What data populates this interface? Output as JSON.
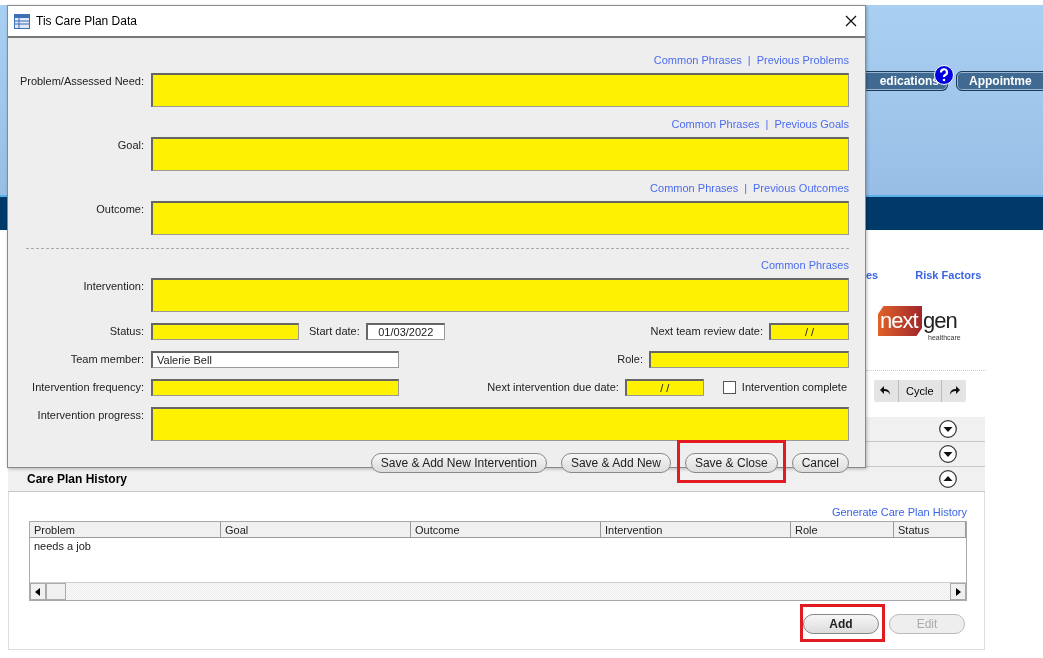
{
  "background": {
    "nav_buttons": [
      {
        "label": "edications"
      },
      {
        "label": "Appointme"
      }
    ],
    "links": [
      "es",
      "Risk Factors"
    ],
    "logo": {
      "first": "next",
      "second": "gen",
      "tagline": "healthcare"
    },
    "toolbar": {
      "label": "Cycle"
    },
    "sections": [
      {
        "expanded": false
      },
      {
        "expanded": false
      },
      {
        "title": "Care Plan History",
        "expanded": true
      }
    ],
    "history": {
      "link": "Generate Care Plan History",
      "columns": [
        "Problem",
        "Goal",
        "Outcome",
        "Intervention",
        "Role",
        "Status"
      ],
      "rows": [
        {
          "cells": [
            "needs a job"
          ]
        }
      ],
      "buttons": [
        {
          "label": "Add",
          "disabled": false,
          "highlighted": true
        },
        {
          "label": "Edit",
          "disabled": true,
          "highlighted": false
        }
      ]
    }
  },
  "dialog": {
    "title": "Tis Care Plan Data",
    "text_areas": [
      {
        "label": "Problem/Assessed Need:",
        "required": true,
        "divider_before": false,
        "links": [
          "Common Phrases",
          "|",
          "Previous Problems"
        ]
      },
      {
        "label": "Goal:",
        "required": true,
        "divider_before": false,
        "links": [
          "Common Phrases",
          "|",
          "Previous Goals"
        ]
      },
      {
        "label": "Outcome:",
        "required": true,
        "divider_before": false,
        "links": [
          "Common Phrases",
          "|",
          "Previous Outcomes"
        ]
      },
      {
        "label": "Intervention:",
        "required": true,
        "divider_before": true,
        "links": [
          "Common Phrases"
        ]
      }
    ],
    "status": {
      "label": "Status:",
      "required": true
    },
    "start_date": {
      "label": "Start date:",
      "value": "01/03/2022",
      "required": false
    },
    "next_team_review_date": {
      "label": "Next team review date:",
      "value": "/ /",
      "required": true
    },
    "team_member": {
      "label": "Team member:",
      "value": "Valerie Bell",
      "required": false
    },
    "role": {
      "label": "Role:",
      "required": true
    },
    "intervention_frequency": {
      "label": "Intervention frequency:",
      "required": true
    },
    "next_intervention_due_date": {
      "label": "Next intervention due date:",
      "value": "/ /",
      "required": true
    },
    "intervention_complete": {
      "label": "Intervention complete",
      "checked": false
    },
    "intervention_progress": {
      "label": "Intervention progress:",
      "required": true
    },
    "buttons": [
      {
        "label": "Save & Add New Intervention",
        "highlighted": false
      },
      {
        "label": "Save & Add New",
        "highlighted": false
      },
      {
        "label": "Save & Close",
        "highlighted": true
      },
      {
        "label": "Cancel",
        "highlighted": false
      }
    ]
  }
}
